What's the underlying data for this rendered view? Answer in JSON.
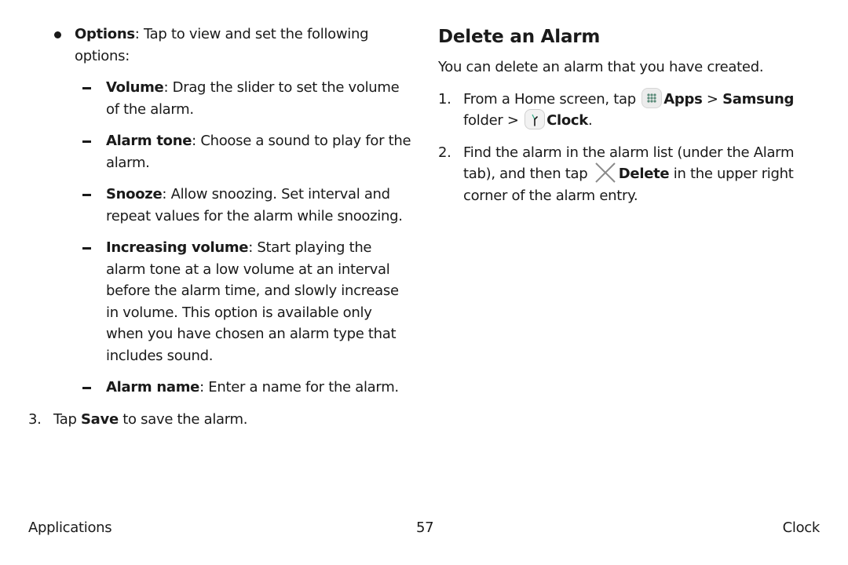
{
  "left_column": {
    "options_item": {
      "term": "Options",
      "text": ": Tap to view and set the following options:"
    },
    "sub_items": [
      {
        "term": "Volume",
        "text": ": Drag the slider to set the volume of the alarm."
      },
      {
        "term": "Alarm tone",
        "text": ": Choose a sound to play for the alarm."
      },
      {
        "term": "Snooze",
        "text": ": Allow snoozing. Set interval and repeat values for the alarm while snoozing."
      },
      {
        "term": "Increasing volume",
        "text": ": Start playing the alarm tone at a low volume at an interval before the alarm time, and slowly increase in volume. This option is available only when you have chosen an alarm type that includes sound."
      },
      {
        "term": "Alarm name",
        "text": ": Enter a name for the alarm."
      }
    ],
    "step3": {
      "number": "3.",
      "pre": "Tap ",
      "term": "Save",
      "post": " to save the alarm."
    }
  },
  "right_column": {
    "heading": "Delete an Alarm",
    "intro": "You can delete an alarm that you have created.",
    "step1": {
      "number": "1.",
      "pre": "From a Home screen, tap ",
      "apps_icon": "apps-grid-icon",
      "apps_label": "Apps",
      "sep1": " > ",
      "samsung_label": "Samsung",
      "folder_text": " folder > ",
      "clock_icon": "clock-app-icon",
      "clock_label": "Clock",
      "end": "."
    },
    "step2": {
      "number": "2.",
      "pre": "Find the alarm in the alarm list (under the Alarm tab), and then tap ",
      "delete_icon": "close-x-icon",
      "delete_label": "Delete",
      "post": " in the upper right corner of the alarm entry."
    }
  },
  "footer": {
    "section": "Applications",
    "page_number": "57",
    "chapter": "Clock"
  },
  "colors": {
    "text": "#1a1a1a",
    "apps_dots": "#5a8a78",
    "clock_hand_accent": "#2aa882",
    "x_icon": "#8a8a8a"
  }
}
